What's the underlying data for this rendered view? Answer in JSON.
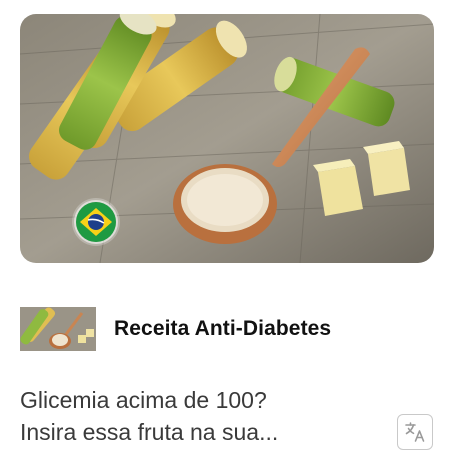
{
  "ad": {
    "image": {
      "icon": "sugarcane-photo",
      "badge_icon": "brazil-flag-icon"
    },
    "advertiser": {
      "name": "Receita Anti-Diabetes",
      "thumb_icon": "sugarcane-thumbnail"
    },
    "headline_line1": "Glicemia acima de 100?",
    "headline_line2": "Insira essa fruta na sua...",
    "translate_icon": "translate-icon"
  },
  "colors": {
    "text_title": "#111111",
    "text_body": "#3a3a3a",
    "border": "#c9c9c9"
  }
}
